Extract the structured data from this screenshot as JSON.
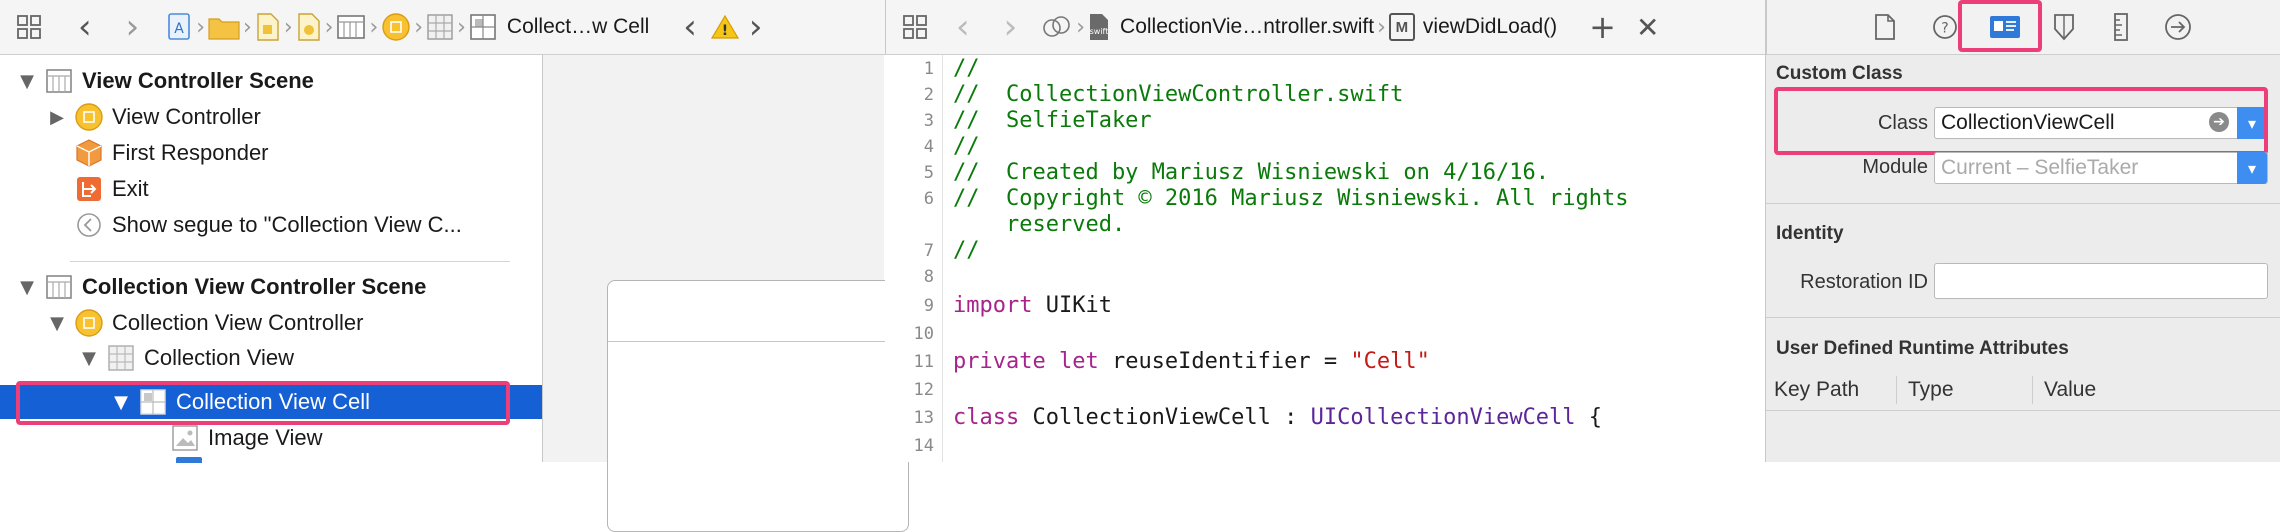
{
  "jump_bar_left": {
    "breadcrumb_current": "Collect…w Cell"
  },
  "jump_bar_editor": {
    "file": "CollectionVie…ntroller.swift",
    "method_badge": "M",
    "method": "viewDidLoad()"
  },
  "outline": {
    "rows": [
      {
        "label": "View Controller Scene"
      },
      {
        "label": "View Controller"
      },
      {
        "label": "First Responder"
      },
      {
        "label": "Exit"
      },
      {
        "label": "Show segue to \"Collection View C..."
      },
      {
        "label": "Collection View Controller Scene"
      },
      {
        "label": "Collection View Controller"
      },
      {
        "label": "Collection View"
      },
      {
        "label": "Collection View Cell"
      },
      {
        "label": "Image View"
      }
    ]
  },
  "editor": {
    "line_numbers": [
      "1",
      "2",
      "3",
      "4",
      "5",
      "6",
      "",
      "7",
      "8",
      "9",
      "10",
      "11",
      "12",
      "13",
      "14"
    ],
    "lines": [
      "//",
      "//  CollectionViewController.swift",
      "//  SelfieTaker",
      "//",
      "//  Created by Mariusz Wisniewski on 4/16/16.",
      "//  Copyright © 2016 Mariusz Wisniewski. All rights",
      "    reserved.",
      "//",
      "",
      "import",
      " UIKit",
      "private let",
      " reuseIdentifier = ",
      "\"Cell\"",
      "class",
      " CollectionViewCell : ",
      "UICollectionViewCell",
      " {"
    ]
  },
  "inspector": {
    "custom_class": {
      "heading": "Custom Class",
      "class_label": "Class",
      "class_value": "CollectionViewCell",
      "module_label": "Module",
      "module_placeholder": "Current – SelfieTaker"
    },
    "identity": {
      "heading": "Identity",
      "restoration_label": "Restoration ID",
      "restoration_value": ""
    },
    "runtime_attrs": {
      "heading": "User Defined Runtime Attributes",
      "columns": [
        "Key Path",
        "Type",
        "Value"
      ]
    }
  },
  "colors": {
    "selection": "#1560d4",
    "highlight": "#ec3f7a",
    "accent": "#3d8ef0",
    "comment": "#0a7a0a",
    "keyword": "#a5248d",
    "string": "#c41a16"
  }
}
